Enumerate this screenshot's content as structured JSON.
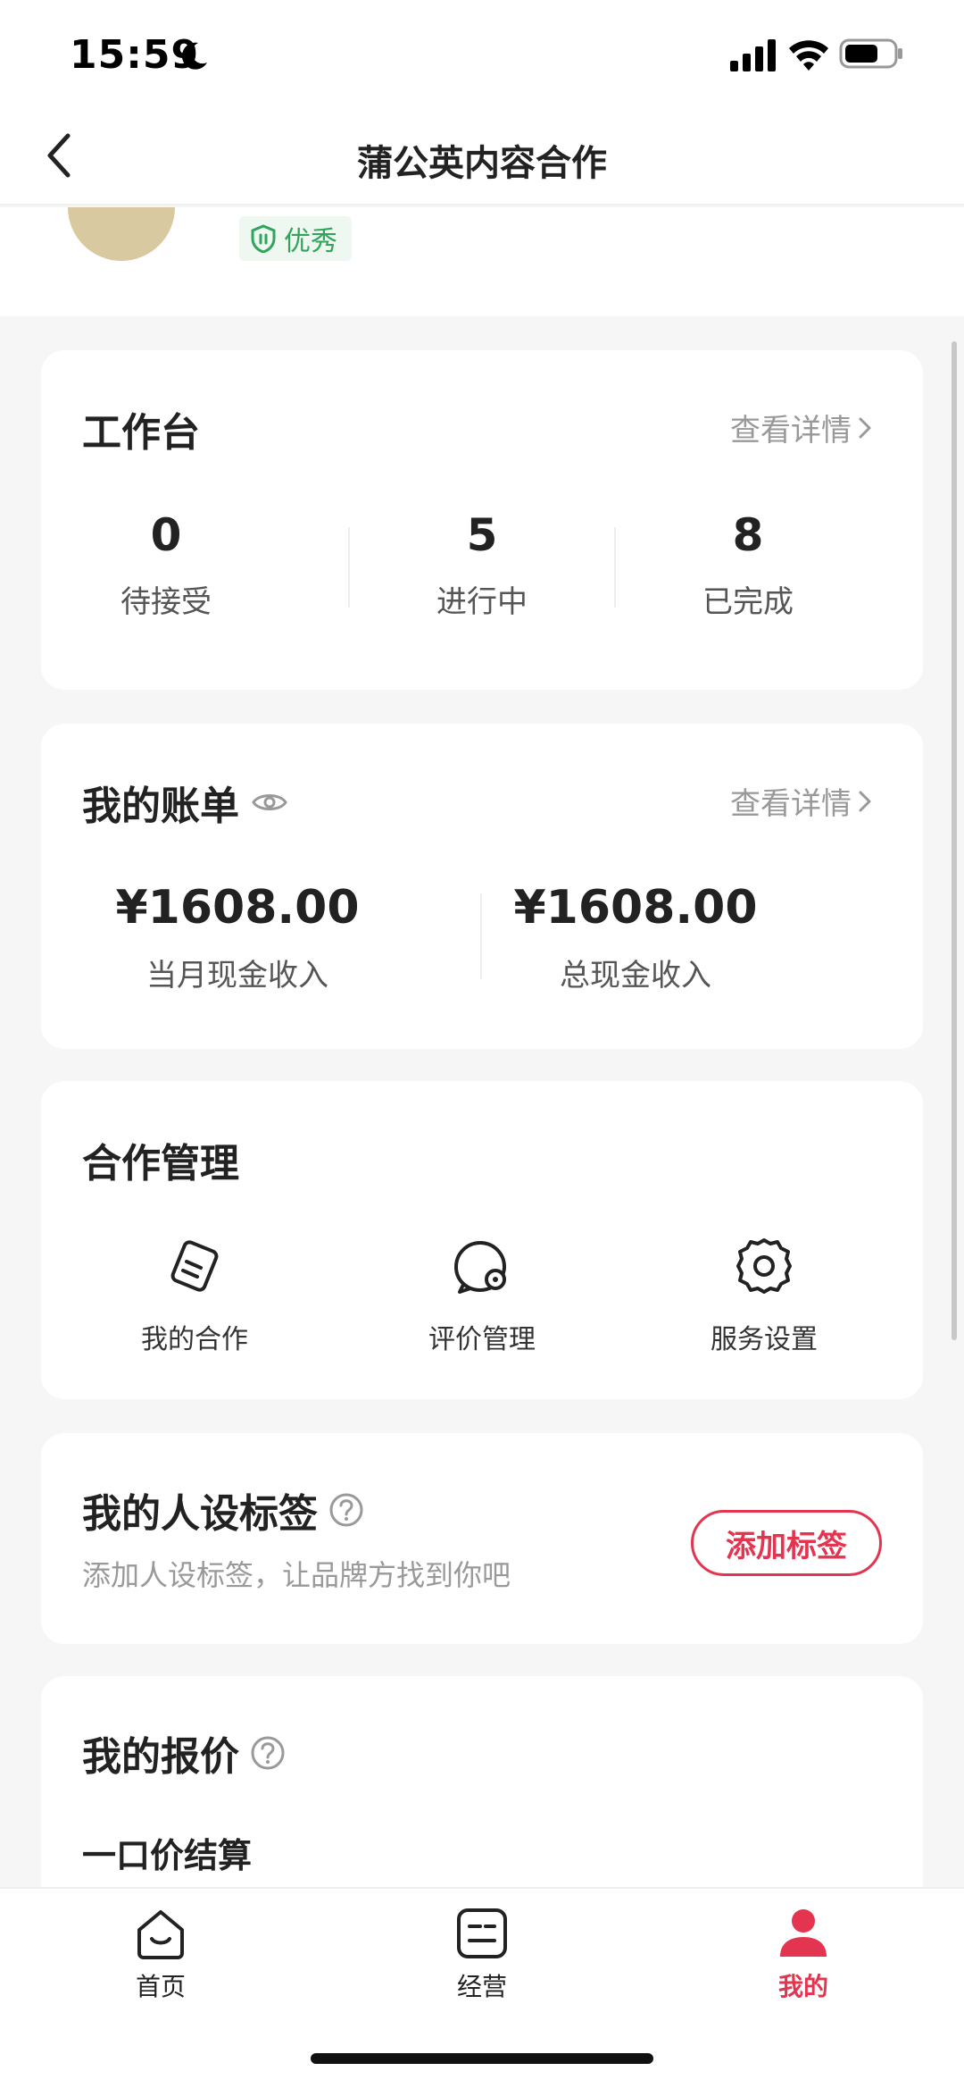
{
  "status_bar": {
    "time": "15:59"
  },
  "nav": {
    "title": "蒲公英内容合作"
  },
  "profile": {
    "level": "优秀"
  },
  "workbench": {
    "title": "工作台",
    "detail": "查看详情",
    "stats": [
      {
        "value": "0",
        "label": "待接受"
      },
      {
        "value": "5",
        "label": "进行中"
      },
      {
        "value": "8",
        "label": "已完成"
      }
    ]
  },
  "bill": {
    "title": "我的账单",
    "detail": "查看详情",
    "items": [
      {
        "value": "¥1608.00",
        "label": "当月现金收入"
      },
      {
        "value": "¥1608.00",
        "label": "总现金收入"
      }
    ]
  },
  "coop": {
    "title": "合作管理",
    "tools": [
      {
        "label": "我的合作",
        "icon": "coop-icon"
      },
      {
        "label": "评价管理",
        "icon": "review-icon"
      },
      {
        "label": "服务设置",
        "icon": "gear-icon"
      }
    ]
  },
  "persona": {
    "title": "我的人设标签",
    "subtitle": "添加人设标签，让品牌方找到你吧",
    "button": "添加标签"
  },
  "pricing": {
    "title": "我的报价",
    "subtitle": "一口价结算"
  },
  "tabs": [
    {
      "label": "首页",
      "icon": "home-icon"
    },
    {
      "label": "经营",
      "icon": "business-icon"
    },
    {
      "label": "我的",
      "icon": "profile-icon"
    }
  ],
  "colors": {
    "accent": "#e33550",
    "green": "#2fa45a"
  }
}
